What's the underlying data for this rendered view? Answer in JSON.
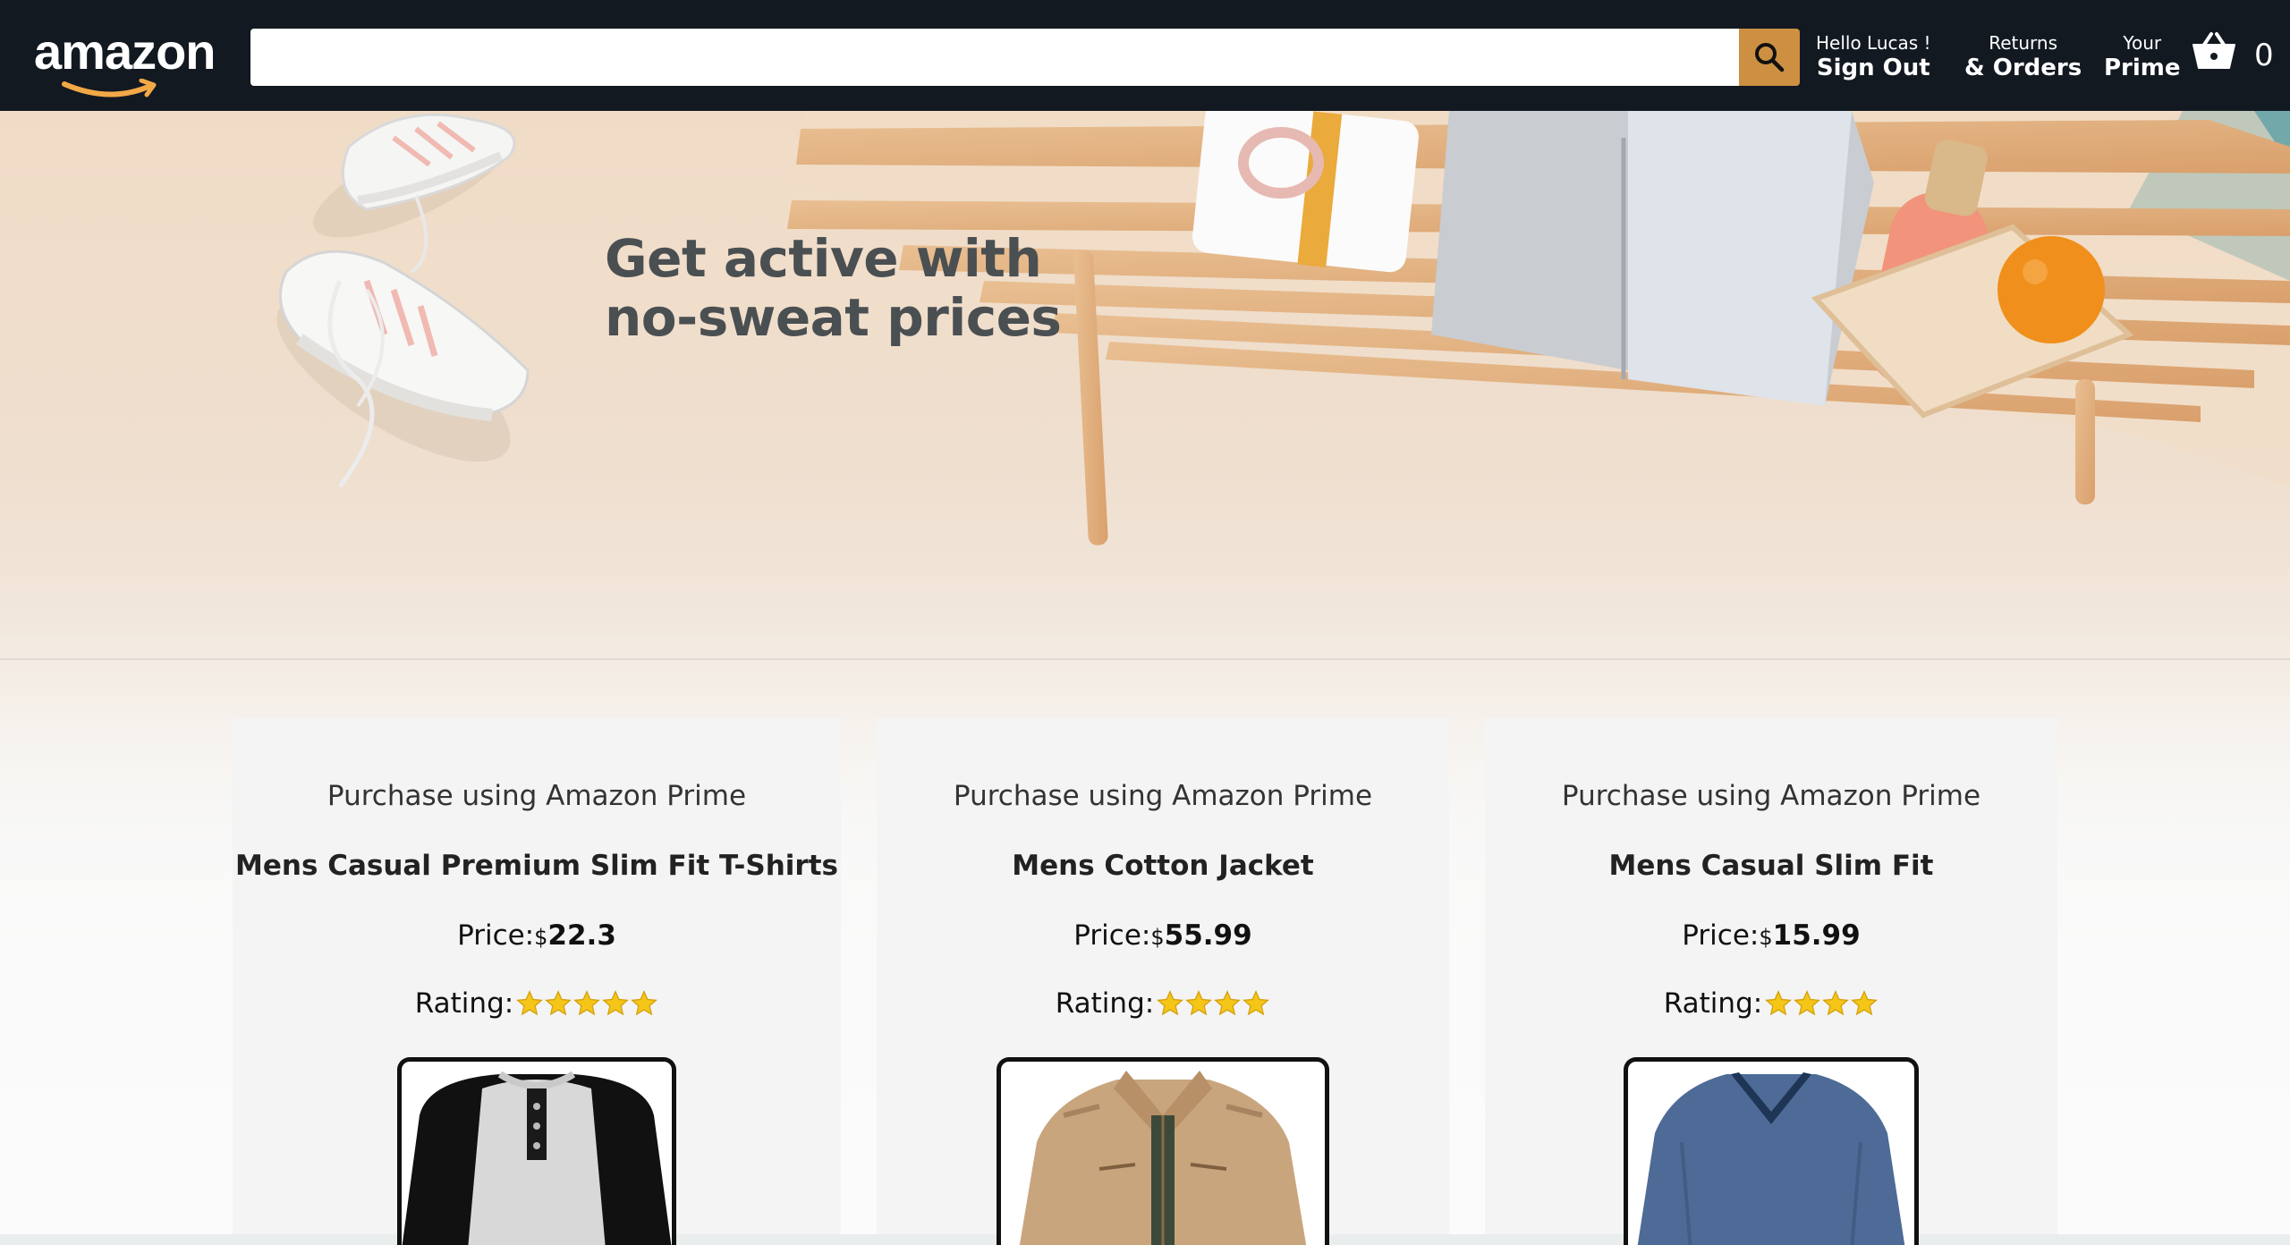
{
  "header": {
    "logo": "amazon",
    "search": {
      "value": "",
      "placeholder": ""
    },
    "greeting": "Hello Lucas !",
    "sign_out": "Sign Out",
    "returns_line1": "Returns",
    "returns_line2": "& Orders",
    "prime_line1": "Your",
    "prime_line2": "Prime",
    "basket_count": "0"
  },
  "hero": {
    "title": "Get active with\nno-sweat prices"
  },
  "products": [
    {
      "caption": "Purchase using Amazon Prime",
      "title": "Mens Casual Premium Slim Fit T-Shirts",
      "price_label": "Price:",
      "currency": "$",
      "price": "22.3",
      "rating_label": "Rating:",
      "rating": 5,
      "image": "raglan-henley-shirt"
    },
    {
      "caption": "Purchase using Amazon Prime",
      "title": "Mens Cotton Jacket",
      "price_label": "Price:",
      "currency": "$",
      "price": "55.99",
      "rating_label": "Rating:",
      "rating": 4,
      "image": "khaki-cotton-jacket"
    },
    {
      "caption": "Purchase using Amazon Prime",
      "title": "Mens Casual Slim Fit",
      "price_label": "Price:",
      "currency": "$",
      "price": "15.99",
      "rating_label": "Rating:",
      "rating": 4,
      "image": "navy-vneck-longsleeve"
    }
  ],
  "colors": {
    "header_bg": "#131921",
    "search_button": "#cd9042",
    "logo_smile": "#f3a847",
    "star": "#f5c518"
  }
}
